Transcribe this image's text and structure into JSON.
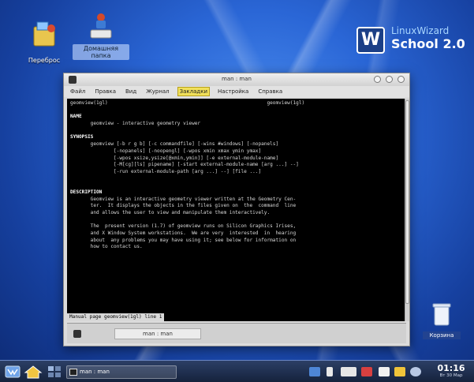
{
  "desktop": {
    "icons": [
      {
        "label": "Переброс"
      },
      {
        "label": "Домашняя папка"
      }
    ],
    "trash_label": "Корзина",
    "brand": {
      "line1": "LinuxWizard",
      "line2": "School 2.0",
      "badge": "W"
    }
  },
  "window": {
    "title": "man : man",
    "menu": [
      "Файл",
      "Правка",
      "Вид",
      "Журнал",
      "Закладки",
      "Настройка",
      "Справка"
    ],
    "active_menu_index": 4,
    "tab_label": "man : man",
    "terminal_lines": [
      {
        "t": "geomview(1gl)                                                       geomview(1gl)",
        "b": false
      },
      {
        "t": "",
        "b": false
      },
      {
        "t": "NAME",
        "b": true
      },
      {
        "t": "       geomview - interactive geometry viewer",
        "b": false
      },
      {
        "t": "",
        "b": false
      },
      {
        "t": "SYNOPSIS",
        "b": true
      },
      {
        "t": "       geomview [-b r g b] [-c commandfile] [-wins #windows] [-nopanels]",
        "b": false
      },
      {
        "t": "               [-nopanels] [-noopengl] [-wpos xmin xmax ymin ymax]",
        "b": false
      },
      {
        "t": "               [-wpos xsize,ysize[@xmin,ymin]] [-e external-module-name]",
        "b": false
      },
      {
        "t": "               [-M[cg][ls] pipename] [-start external-module-name [arg ...] --]",
        "b": false
      },
      {
        "t": "               [-run external-module-path [arg ...] --] [file ...]",
        "b": false
      },
      {
        "t": "",
        "b": false
      },
      {
        "t": "",
        "b": false
      },
      {
        "t": "DESCRIPTION",
        "b": true
      },
      {
        "t": "       Geomview is an interactive geometry viewer written at the Geometry Cen-",
        "b": false
      },
      {
        "t": "       ter.  It displays the objects in the files given on  the  command  line",
        "b": false
      },
      {
        "t": "       and allows the user to view and manipulate them interactively.",
        "b": false
      },
      {
        "t": "",
        "b": false
      },
      {
        "t": "       The  present version (1.7) of geomview runs on Silicon Graphics Irises,",
        "b": false
      },
      {
        "t": "       and X Window System workstations.  We are very  interested  in  hearing",
        "b": false
      },
      {
        "t": "       about  any problems you may have using it; see below for information on",
        "b": false
      },
      {
        "t": "       how to contact us.",
        "b": false
      }
    ],
    "status_line": "Manual page geomview(1gl) line 1"
  },
  "taskbar": {
    "task_label": "man : man",
    "clock_time": "01:16",
    "clock_date": "Вт 30 Мар"
  }
}
